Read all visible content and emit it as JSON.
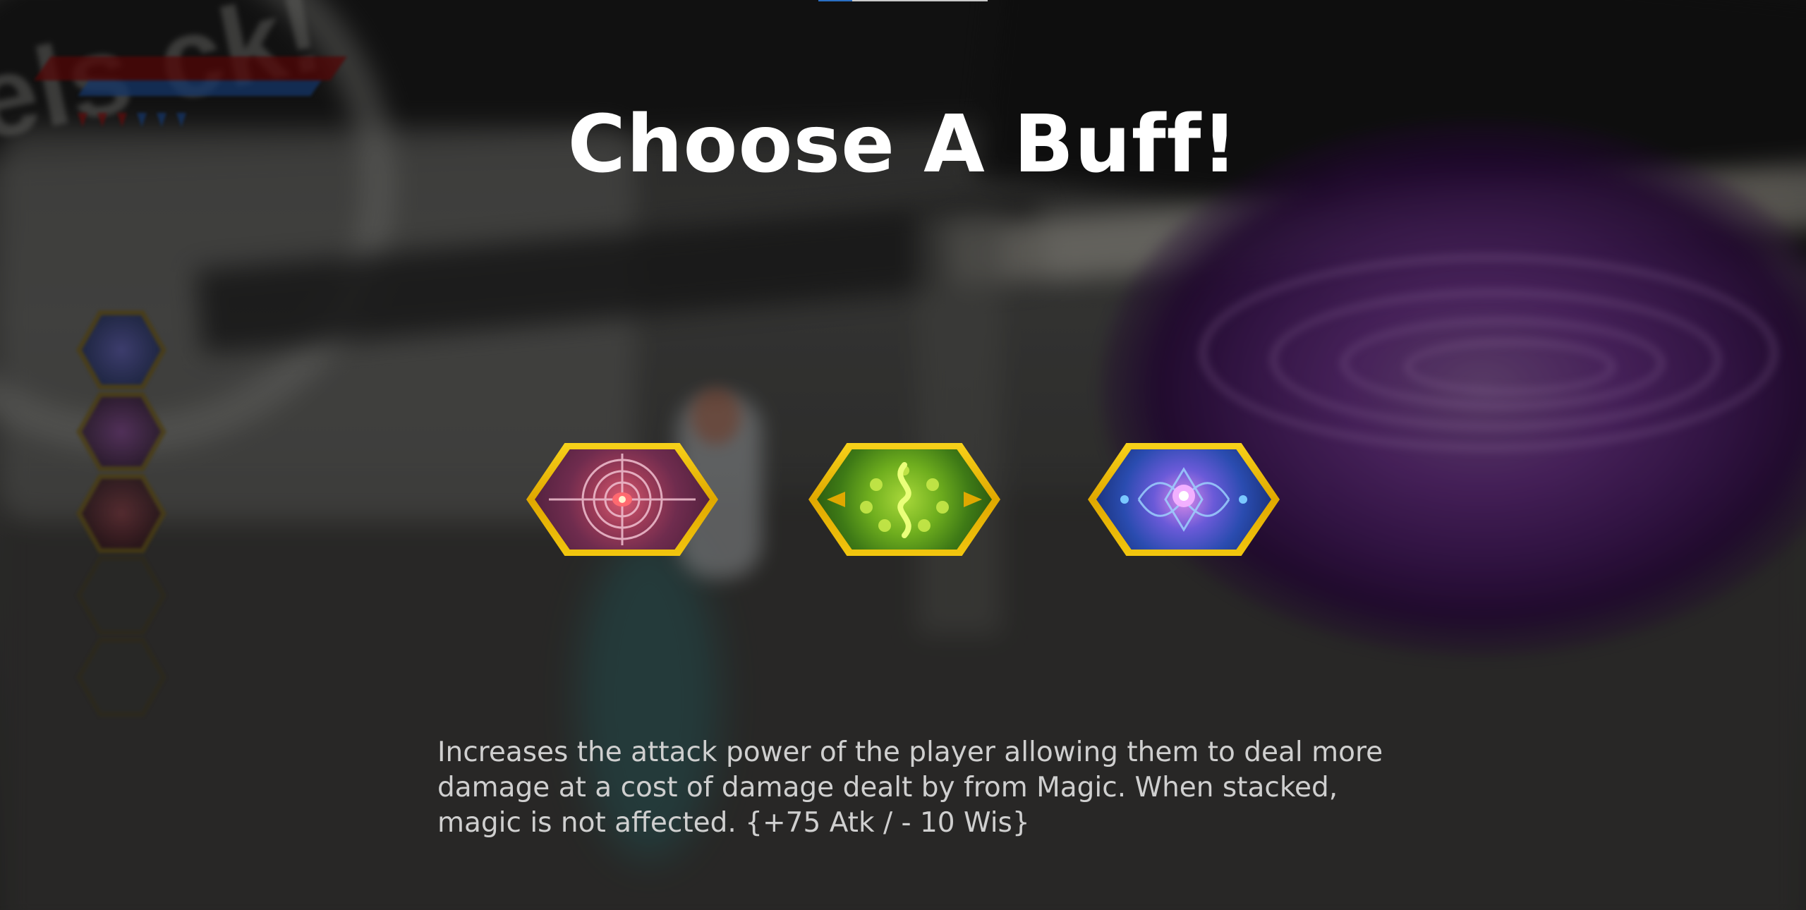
{
  "title": "Choose A Buff!",
  "background_scene_text": "els ck!",
  "hud": {
    "health_color": "#7a0a0a",
    "mana_color": "#1e4f9a",
    "pips": [
      "red",
      "red",
      "red",
      "blue",
      "blue",
      "blue"
    ],
    "buff_slots": [
      {
        "state": "filled",
        "icon": "magic-buff-icon"
      },
      {
        "state": "filled",
        "icon": "dark-buff-icon"
      },
      {
        "state": "filled",
        "icon": "attack-buff-icon"
      },
      {
        "state": "empty"
      },
      {
        "state": "empty"
      }
    ]
  },
  "buffs": [
    {
      "id": "attack",
      "icon": "attack-buff-icon",
      "color": "#9b3a57",
      "frame": "#f2c60e"
    },
    {
      "id": "poison",
      "icon": "poison-buff-icon",
      "color": "#6fae1e",
      "frame": "#f2c60e"
    },
    {
      "id": "magic",
      "icon": "magic-buff-icon",
      "color": "#2a4cb0",
      "frame": "#f2c60e"
    }
  ],
  "description": {
    "line1": "Increases the attack power of the player allowing them to deal more",
    "line2": "damage at a cost of damage dealt by from Magic. When stacked,",
    "line3": "magic is not affected. {+75 Atk / - 10 Wis}"
  }
}
